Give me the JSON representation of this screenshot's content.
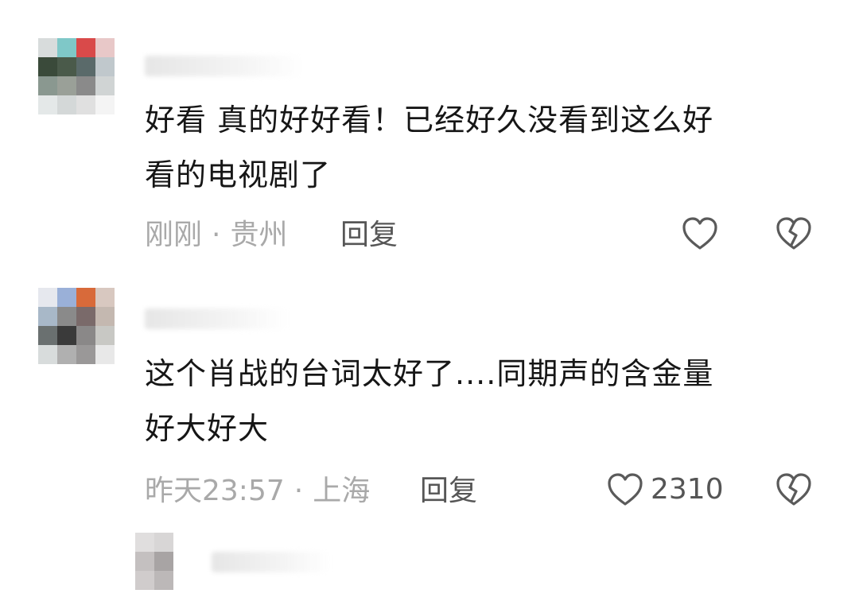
{
  "comments": [
    {
      "text_line1": "好看 真的好好看！已经好久没看到这么好",
      "text_line2": "看的电视剧了",
      "time": "刚刚",
      "location": "贵州",
      "reply_label": "回复",
      "like_count": "",
      "like_icon": "heart-outline-icon",
      "dislike_icon": "broken-heart-icon",
      "avatar_colors": [
        "#d8dcdc",
        "#7fc8c8",
        "#d94a4a",
        "#e8c8c8",
        "#3a4a3a",
        "#4a5a4a",
        "#5a6a6a",
        "#c0c8cc",
        "#8a9890",
        "#9aa098",
        "#8a8a8a",
        "#d0d4d4",
        "#e4e8e8",
        "#d4d8d8",
        "#e0e0e0",
        "#f4f4f4"
      ]
    },
    {
      "text_line1": "这个肖战的台词太好了....同期声的含金量",
      "text_line2": "好大好大",
      "time": "昨天23:57",
      "location": "上海",
      "reply_label": "回复",
      "like_count": "2310",
      "like_icon": "heart-outline-icon",
      "dislike_icon": "broken-heart-icon",
      "avatar_colors": [
        "#e6e8ee",
        "#9ab0d8",
        "#d86a3a",
        "#d8c8c0",
        "#a8b8c8",
        "#8a8a8a",
        "#7a6a6a",
        "#c4b8b0",
        "#6a7070",
        "#3a3a3a",
        "#8a8888",
        "#c8c8c4",
        "#d8dcdc",
        "#b0b0b0",
        "#9a9898",
        "#e8e8e8"
      ]
    },
    {
      "avatar_colors": [
        "#ffffff",
        "#e0dede",
        "#d8d6d6",
        "#ffffff",
        "#ffffff",
        "#c4c0c0",
        "#a8a4a4",
        "#ffffff",
        "#ffffff",
        "#d0cccc",
        "#bcb8b8",
        "#ffffff",
        "#ffffff",
        "#ffffff",
        "#ffffff",
        "#ffffff"
      ]
    }
  ],
  "separator": "·"
}
